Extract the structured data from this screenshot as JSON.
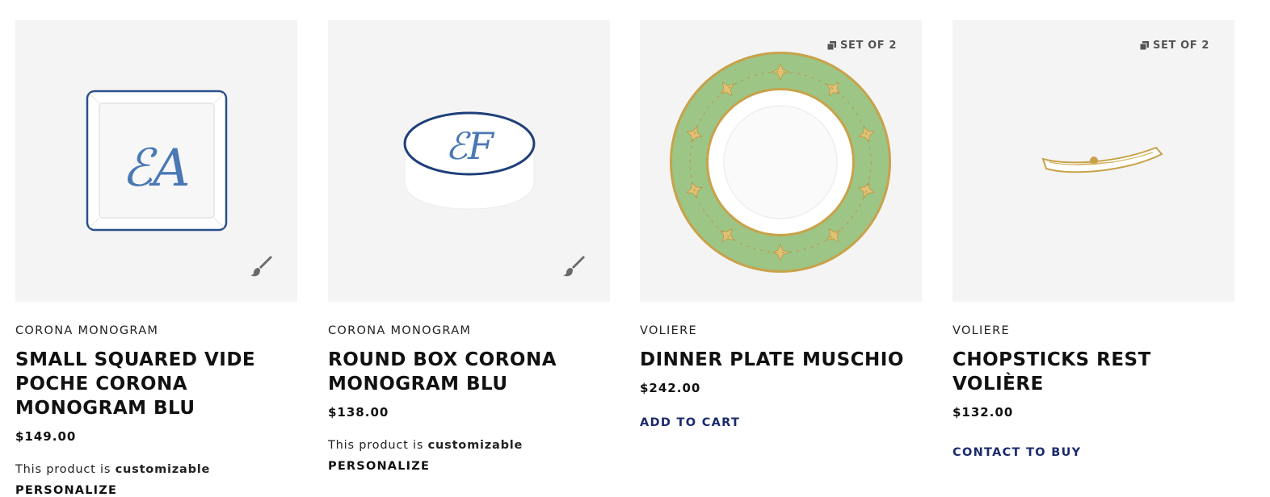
{
  "products": [
    {
      "collection": "CORONA MONOGRAM",
      "title": "SMALL SQUARED VIDE POCHE CORONA MONOGRAM BLU",
      "price": "$149.00",
      "note_prefix": "This product is ",
      "note_strong": "customizable",
      "personalize": "PERSONALIZE",
      "icon": "paint-brush-icon"
    },
    {
      "collection": "CORONA MONOGRAM",
      "title": "ROUND BOX CORONA MONOGRAM BLU",
      "price": "$138.00",
      "note_prefix": "This product is ",
      "note_strong": "customizable",
      "personalize": "PERSONALIZE",
      "icon": "paint-brush-icon"
    },
    {
      "collection": "VOLIERE",
      "title": "DINNER PLATE MUSCHIO",
      "price": "$242.00",
      "badge": "SET OF 2",
      "cta": "ADD TO CART",
      "icon": "stack-icon"
    },
    {
      "collection": "VOLIERE",
      "title": "CHOPSTICKS REST VOLIÈRE",
      "price": "$132.00",
      "badge": "SET OF 2",
      "cta": "CONTACT TO BUY",
      "icon": "stack-icon"
    }
  ],
  "colors": {
    "image_bg": "#f4f4f4",
    "cta": "#1b2a6e",
    "monogram_blue": "#2a4f8a",
    "plate_green": "#9dc585",
    "gold": "#c8a24a"
  }
}
